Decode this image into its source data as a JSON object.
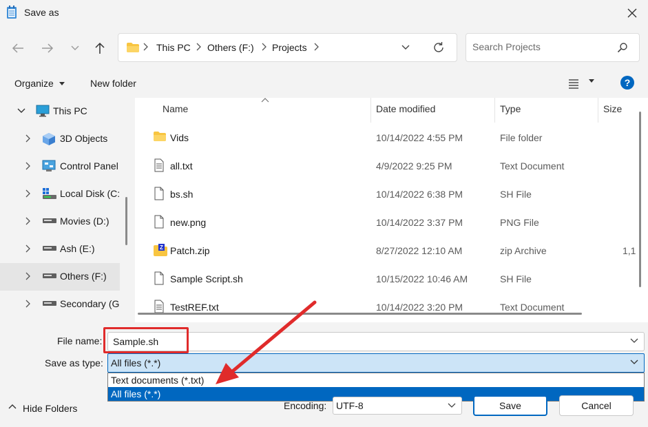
{
  "window": {
    "title": "Save as"
  },
  "address": {
    "crumbs": [
      "This PC",
      "Others (F:)",
      "Projects"
    ]
  },
  "search": {
    "placeholder": "Search Projects"
  },
  "toolbar": {
    "organize": "Organize",
    "new_folder": "New folder",
    "help": "?"
  },
  "tree": [
    {
      "label": "This PC",
      "icon": "monitor-icon",
      "expanded": true
    },
    {
      "label": "3D Objects",
      "icon": "cube-icon"
    },
    {
      "label": "Control Panel",
      "icon": "control-panel-icon"
    },
    {
      "label": "Local Disk (C:)",
      "icon": "system-drive-icon"
    },
    {
      "label": "Movies (D:)",
      "icon": "drive-icon"
    },
    {
      "label": "Ash (E:)",
      "icon": "drive-icon"
    },
    {
      "label": "Others (F:)",
      "icon": "drive-icon",
      "selected": true
    },
    {
      "label": "Secondary (G:)",
      "icon": "drive-icon"
    }
  ],
  "columns": {
    "name": "Name",
    "date": "Date modified",
    "type": "Type",
    "size": "Size"
  },
  "files": [
    {
      "name": "Vids",
      "date": "10/14/2022 4:55 PM",
      "type": "File folder",
      "size": "",
      "icon": "folder-icon"
    },
    {
      "name": "all.txt",
      "date": "4/9/2022 9:25 PM",
      "type": "Text Document",
      "size": "",
      "icon": "text-file-icon"
    },
    {
      "name": "bs.sh",
      "date": "10/14/2022 6:38 PM",
      "type": "SH File",
      "size": "",
      "icon": "file-icon"
    },
    {
      "name": "new.png",
      "date": "10/14/2022 3:37 PM",
      "type": "PNG File",
      "size": "",
      "icon": "file-icon"
    },
    {
      "name": "Patch.zip",
      "date": "8/27/2022 12:10 AM",
      "type": "zip Archive",
      "size": "1,1",
      "icon": "zip-folder-icon"
    },
    {
      "name": "Sample Script.sh",
      "date": "10/15/2022 10:46 AM",
      "type": "SH File",
      "size": "",
      "icon": "file-icon"
    },
    {
      "name": "TestREF.txt",
      "date": "10/14/2022 3:20 PM",
      "type": "Text Document",
      "size": "",
      "icon": "text-file-icon"
    }
  ],
  "form": {
    "file_name_label": "File name:",
    "file_name_value": "Sample.sh",
    "save_type_label": "Save as type:",
    "save_type_value": "All files  (*.*)",
    "save_type_options": [
      "Text documents (*.txt)",
      "All files  (*.*)"
    ],
    "encoding_label": "Encoding:",
    "encoding_value": "UTF-8"
  },
  "footer": {
    "hide_folders": "Hide Folders",
    "save": "Save",
    "cancel": "Cancel"
  },
  "colors": {
    "accent": "#0067c0",
    "annotation": "#e02b2b",
    "selection": "#cce4f7"
  }
}
